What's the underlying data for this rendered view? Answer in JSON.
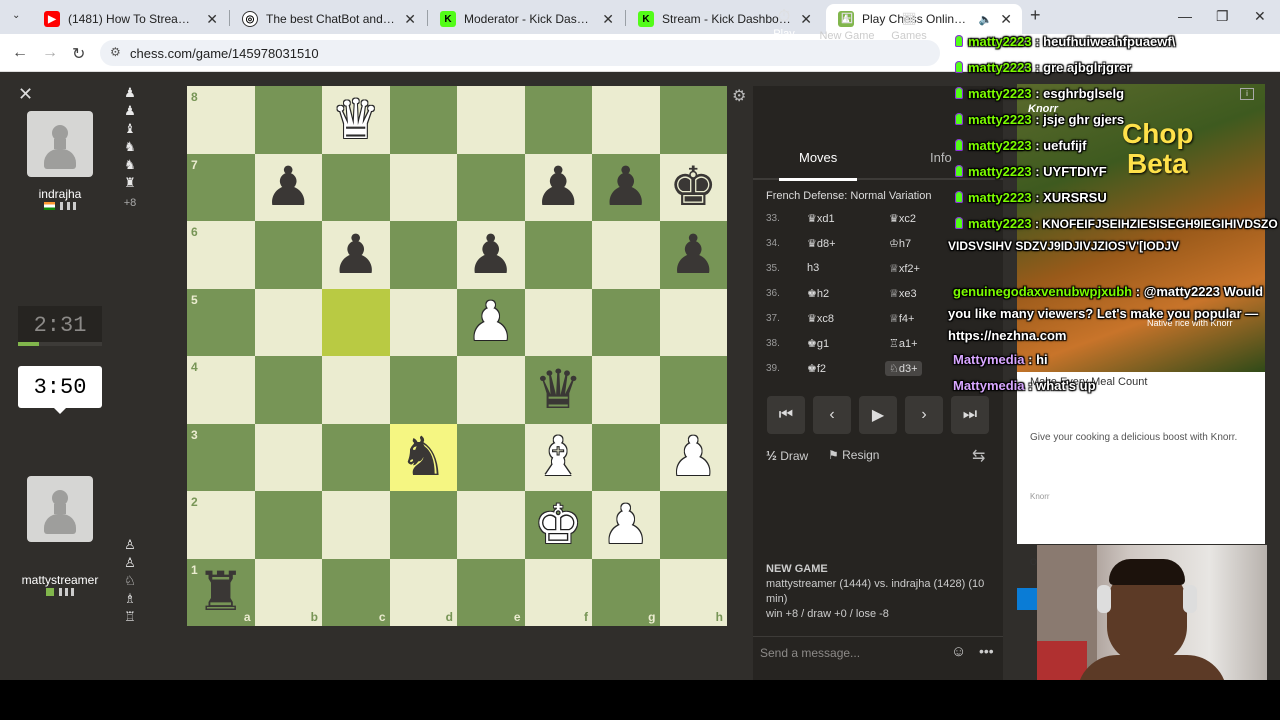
{
  "browser": {
    "tabs": [
      {
        "title": "(1481) How To Stream On Kick ...",
        "icon": "youtube-icon",
        "color": "#ff0000"
      },
      {
        "title": "The best ChatBot and Widgets ...",
        "icon": "botrix-icon",
        "color": "#222222"
      },
      {
        "title": "Moderator - Kick Dashboard",
        "icon": "kick-icon",
        "color": "#53fc18"
      },
      {
        "title": "Stream - Kick Dashboard",
        "icon": "kick-icon",
        "color": "#53fc18"
      },
      {
        "title": "Play Chess Online for FREE ...",
        "icon": "chess-pawn-icon",
        "color": "#81b64c"
      }
    ],
    "url": "chess.com/game/145978031510"
  },
  "players": {
    "top": {
      "name": "indrajha",
      "flag": "India",
      "clock": "2:31",
      "clock_progress": 0.25,
      "captured": [
        "♟",
        "♟",
        "♝",
        "♞",
        "♞",
        "♜"
      ],
      "advantage": "+8"
    },
    "bottom": {
      "name": "mattystreamer",
      "clock": "3:50",
      "captured": [
        "♙",
        "♙",
        "♘",
        "♗",
        "♖"
      ]
    }
  },
  "board": {
    "ranks": [
      "8",
      "7",
      "6",
      "5",
      "4",
      "3",
      "2",
      "1"
    ],
    "files": [
      "a",
      "b",
      "c",
      "d",
      "e",
      "f",
      "g",
      "h"
    ],
    "pieces": [
      {
        "sq": "c8",
        "glyph": "♛",
        "side": "w"
      },
      {
        "sq": "b7",
        "glyph": "♟",
        "side": "b"
      },
      {
        "sq": "f7",
        "glyph": "♟",
        "side": "b"
      },
      {
        "sq": "g7",
        "glyph": "♟",
        "side": "b"
      },
      {
        "sq": "h7",
        "glyph": "♚",
        "side": "b"
      },
      {
        "sq": "c6",
        "glyph": "♟",
        "side": "b"
      },
      {
        "sq": "e6",
        "glyph": "♟",
        "side": "b"
      },
      {
        "sq": "h6",
        "glyph": "♟",
        "side": "b"
      },
      {
        "sq": "e5",
        "glyph": "♟",
        "side": "w"
      },
      {
        "sq": "f4",
        "glyph": "♛",
        "side": "b"
      },
      {
        "sq": "d3",
        "glyph": "♞",
        "side": "b"
      },
      {
        "sq": "f3",
        "glyph": "♝",
        "side": "w"
      },
      {
        "sq": "h3",
        "glyph": "♟",
        "side": "w"
      },
      {
        "sq": "f2",
        "glyph": "♚",
        "side": "w"
      },
      {
        "sq": "g2",
        "glyph": "♟",
        "side": "w"
      },
      {
        "sq": "a1",
        "glyph": "♜",
        "side": "b"
      }
    ],
    "highlights": [
      "c5",
      "d3"
    ]
  },
  "panel": {
    "tabs": [
      {
        "label": "Play",
        "icon": "stopwatch-icon"
      },
      {
        "label": "New Game",
        "icon": "plus-square-icon"
      },
      {
        "label": "Games",
        "icon": "board-icon"
      }
    ],
    "move_tabs": [
      "Moves",
      "Info"
    ],
    "opening": "French Defense: Normal Variation",
    "moves": [
      {
        "n": "33.",
        "w": "♛xd1",
        "b": "♛xc2"
      },
      {
        "n": "34.",
        "w": "♛d8+",
        "b": "♔h7"
      },
      {
        "n": "35.",
        "w": "h3",
        "b": "♕xf2+"
      },
      {
        "n": "36.",
        "w": "♚h2",
        "b": "♕xe3"
      },
      {
        "n": "37.",
        "w": "♛xc8",
        "b": "♕f4+"
      },
      {
        "n": "38.",
        "w": "♚g1",
        "b": "♖a1+"
      },
      {
        "n": "39.",
        "w": "♚f2",
        "b": "♘d3+"
      }
    ],
    "draw_label": "Draw",
    "resign_label": "Resign",
    "new_game_title": "NEW GAME",
    "new_game_text": "mattystreamer (1444) vs. indrajha (1428) (10 min)",
    "record": "win +8 / draw +0 / lose -8",
    "message_placeholder": "Send a message..."
  },
  "ad": {
    "logo": "Knorr",
    "headline1": "Chop",
    "headline2": "Beta",
    "small": "Native rice with Knorr",
    "title": "Make Every Meal Count",
    "desc": "Give your cooking a delicious boost with Knorr.",
    "brand": "Knorr",
    "o_text": "O"
  },
  "chat": [
    {
      "user": "matty2223",
      "text": "heufhuiweahfpuaewf\\"
    },
    {
      "user": "matty2223",
      "text": "gre ajbglrjgrer"
    },
    {
      "user": "matty2223",
      "text": "esghrbglselg"
    },
    {
      "user": "matty2223",
      "text": "jsje ghr gjers"
    },
    {
      "user": "matty2223",
      "text": "uefufijf"
    },
    {
      "user": "matty2223",
      "text": "UYFTDIYF"
    },
    {
      "user": "matty2223",
      "text": "XURSRSU"
    },
    {
      "user": "matty2223",
      "text": "KNOFEIFJSEIHZIESISEGH9IEGIHIVDSZOVIDSVSIHV SDZVJ9IDJIVJZIOS'V'[IODJV"
    },
    {
      "user": "genuinegodaxvenubwpjxubh",
      "text": "@matty2223 Would you like many viewers? Let's make you popular — https://nezhna.com"
    },
    {
      "user": "Mattymedia",
      "text": "hi"
    },
    {
      "user": "Mattymedia",
      "text": "what's up"
    }
  ]
}
